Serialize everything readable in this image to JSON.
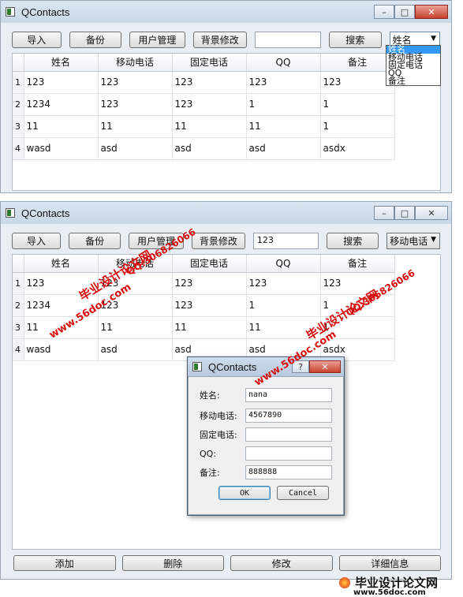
{
  "window1": {
    "title": "QContacts",
    "toolbar": {
      "import": "导入",
      "backup": "备份",
      "user_manage": "用户管理",
      "bg_edit": "背景修改",
      "search_value": "",
      "search": "搜索",
      "select_value": "姓名"
    },
    "dropdown_options": [
      "姓名",
      "移动电话",
      "固定电话",
      "QQ",
      "备注"
    ],
    "columns": [
      "姓名",
      "移动电话",
      "固定电话",
      "QQ",
      "备注"
    ],
    "rows": [
      [
        "1",
        "123",
        "123",
        "123",
        "123",
        "123"
      ],
      [
        "2",
        "1234",
        "123",
        "123",
        "1",
        "1"
      ],
      [
        "3",
        "11",
        "11",
        "11",
        "11",
        "1"
      ],
      [
        "4",
        "wasd",
        "asd",
        "asd",
        "asd",
        "asdx"
      ]
    ]
  },
  "window2": {
    "title": "QContacts",
    "toolbar": {
      "import": "导入",
      "backup": "备份",
      "user_manage": "用户管理",
      "bg_edit": "背景修改",
      "search_value": "123",
      "search": "搜索",
      "select_value": "移动电话"
    },
    "columns": [
      "姓名",
      "移动电话",
      "固定电话",
      "QQ",
      "备注"
    ],
    "rows": [
      [
        "1",
        "123",
        "123",
        "123",
        "123",
        "123"
      ],
      [
        "2",
        "1234",
        "123",
        "123",
        "1",
        "1"
      ],
      [
        "3",
        "11",
        "11",
        "11",
        "11",
        "1"
      ],
      [
        "4",
        "wasd",
        "asd",
        "asd",
        "asd",
        "asdx"
      ]
    ],
    "bottom": {
      "add": "添加",
      "delete": "删除",
      "modify": "修改",
      "detail": "详细信息"
    }
  },
  "dialog": {
    "title": "QContacts",
    "help": "?",
    "fields": [
      {
        "label": "姓名:",
        "value": "nana"
      },
      {
        "label": "移动电话:",
        "value": "4567890"
      },
      {
        "label": "固定电话:",
        "value": ""
      },
      {
        "label": "QQ:",
        "value": ""
      },
      {
        "label": "备注:",
        "value": "888888"
      }
    ],
    "ok": "OK",
    "cancel": "Cancel"
  },
  "watermarks": {
    "site_cn": "毕业设计论文网",
    "qq": "QQ:306826066",
    "url": "www.56doc.com"
  },
  "footer": {
    "text": "毕业设计论文网",
    "url": "www.56doc.com"
  }
}
